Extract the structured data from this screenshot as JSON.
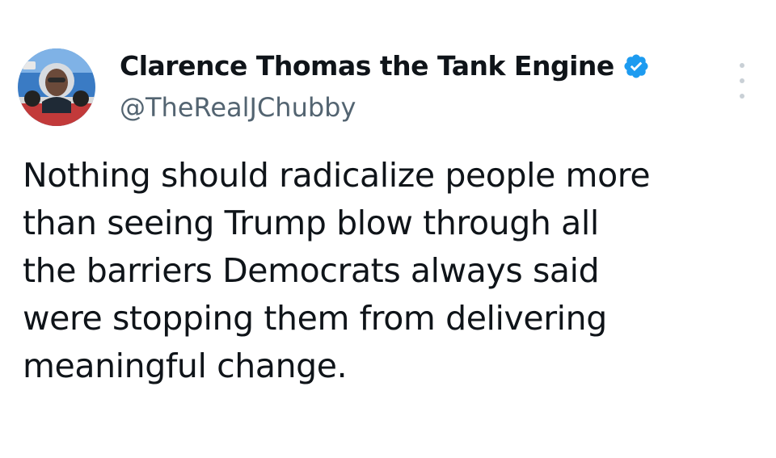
{
  "tweet": {
    "author": {
      "display_name": "Clarence Thomas the Tank Engine",
      "handle": "@TheRealJChubby",
      "verified": true,
      "avatar_icon": "avatar-photo",
      "verified_icon": "verified-badge-icon"
    },
    "body_lines": [
      "Nothing should radicalize people more",
      "than seeing Trump blow through all",
      "the barriers Democrats always said",
      "were stopping them from delivering",
      "meaningful change."
    ],
    "more_icon": "more-options-icon"
  },
  "colors": {
    "text": "#0f1419",
    "handle": "#536471",
    "verified": "#1d9bf0",
    "background": "#ffffff"
  }
}
